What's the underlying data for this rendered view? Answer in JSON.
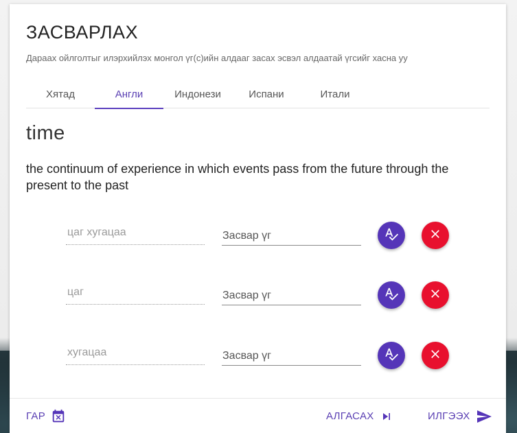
{
  "header": {
    "title": "ЗАСВАРЛАХ",
    "subtitle": "Дараах ойлголтыг илэрхийлэх монгол үг(с)ийн алдааг засах эсвэл алдаатай үгсийг хасна уу"
  },
  "tabs": [
    {
      "label": "Хятад",
      "active": false
    },
    {
      "label": "Англи",
      "active": true
    },
    {
      "label": "Индонези",
      "active": false
    },
    {
      "label": "Испани",
      "active": false
    },
    {
      "label": "Итали",
      "active": false
    }
  ],
  "concept": {
    "word": "time",
    "definition": "the continuum of experience in which events pass from the future through the present to the past"
  },
  "rows": [
    {
      "suggestion": "цаг хугацаа",
      "fix_placeholder": "Засвар үг"
    },
    {
      "suggestion": "цаг",
      "fix_placeholder": "Засвар үг"
    },
    {
      "suggestion": "хугацаа",
      "fix_placeholder": "Засвар үг"
    }
  ],
  "footer": {
    "date_label": "ГАР",
    "skip_label": "АЛГАСАХ",
    "send_label": "ИЛГЭЭХ"
  },
  "colors": {
    "accent": "#5535b8",
    "danger": "#e8102e"
  },
  "icons": {
    "check_button": "spellcheck-icon",
    "remove_button": "close-icon",
    "date_button": "calendar-remove-icon",
    "skip_button": "skip-next-icon",
    "send_button": "send-icon"
  }
}
